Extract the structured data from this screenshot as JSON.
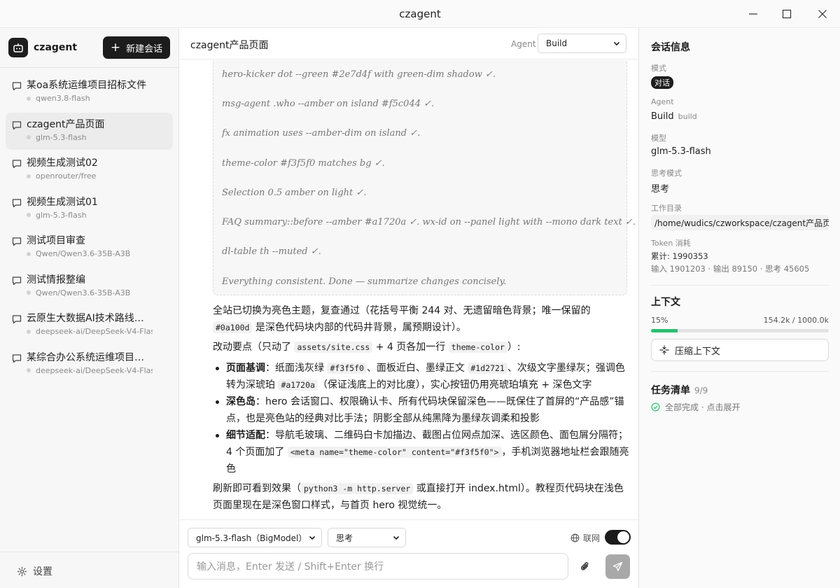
{
  "window": {
    "title": "czagent"
  },
  "sidebar": {
    "brand": "czagent",
    "new_chat_label": "新建会话",
    "conversations": [
      {
        "title": "某oa系统运维项目招标文件",
        "model": "qwen3.8-flash"
      },
      {
        "title": "czagent产品页面",
        "model": "glm-5.3-flash"
      },
      {
        "title": "视频生成测试02",
        "model": "openrouter/free"
      },
      {
        "title": "视频生成测试01",
        "model": "glm-5.3-flash"
      },
      {
        "title": "测试项目审查",
        "model": "Qwen/Qwen3.6-35B-A3B"
      },
      {
        "title": "测试情报整编",
        "model": "Qwen/Qwen3.6-35B-A3B"
      },
      {
        "title": "云原生大数据AI技术路线研究",
        "model": "deepseek-ai/DeepSeek-V4-Flash"
      },
      {
        "title": "某综合办公系统运维项目方案",
        "model": "deepseek-ai/DeepSeek-V4-Flash"
      }
    ],
    "active_index": 1,
    "settings_label": "设置"
  },
  "main": {
    "page_title": "czagent产品页面",
    "agent_label": "Agent",
    "agent_value": "Build",
    "thinking_lines": [
      "hero-kicker dot --green #2e7d4f with green-dim shadow ✓.",
      "msg-agent .who --amber on island #f5c044 ✓.",
      "fx animation uses --amber-dim on island ✓.",
      "theme-color #f3f5f0 matches bg ✓.",
      "Selection 0.5 amber on light ✓.",
      "FAQ summary::before --amber #a1720a ✓. wx-id on --panel light with --mono dark text ✓.",
      "dl-table th --muted ✓.",
      "Everything consistent. Done — summarize changes concisely."
    ],
    "answer": {
      "p1_a": "全站已切换为亮色主题，复查通过（花括号平衡 244 对、无遗留暗色背景；唯一保留的",
      "p1_code": "#0a100d",
      "p1_b": " 是深色代码块内部的代码井背景，属预期设计）。",
      "p2_a": "改动要点（只动了 ",
      "p2_code1": "assets/site.css",
      "p2_b": " + 4 页各加一行 ",
      "p2_code2": "theme-color",
      "p2_c": "）:",
      "b1_title": "页面基调",
      "b1_a": "：纸面浅灰绿 ",
      "b1_code1": "#f3f5f0",
      "b1_b": "、面板近白、墨绿正文 ",
      "b1_code2": "#1d2721",
      "b1_c": "、次级文字墨绿灰；强调色转为深琥珀 ",
      "b1_code3": "#a1720a",
      "b1_d": "（保证浅底上的对比度），实心按钮仍用亮琥珀填充 + 深色文字",
      "b2_title": "深色岛",
      "b2_text": "：hero 会话窗口、权限确认卡、所有代码块保留深色——既保住了首屏的“产品感”锚点，也是亮色站的经典对比手法；阴影全部从纯黑降为墨绿灰调柔和投影",
      "b3_title": "细节适配",
      "b3_a": "：导航毛玻璃、二维码白卡加描边、截图占位网点加深、选区颜色、面包屑分隔符；4 个页面加了 ",
      "b3_code": "<meta name=\"theme-color\" content=\"#f3f5f0\">",
      "b3_b": "，手机浏览器地址栏会跟随亮色",
      "p3_a": "刷新即可看到效果（",
      "p3_code": "python3 -m http.server",
      "p3_b": " 或直接打开 index.html）。教程页代码块在浅色页面里现在是深色窗口样式，与首页 hero 视觉统一。"
    }
  },
  "composer": {
    "model_value": "glm-5.3-flash（BigModel）",
    "thinking_value": "思考",
    "web_label": "联网",
    "web_enabled": true,
    "input_placeholder": "输入消息，Enter 发送 / Shift+Enter 换行"
  },
  "right": {
    "session_title": "会话信息",
    "mode_label": "模式",
    "mode_value": "对话",
    "agent_label": "Agent",
    "agent_value": "Build",
    "agent_sub": "build",
    "model_label": "模型",
    "model_value": "glm-5.3-flash",
    "thinking_label": "思考模式",
    "thinking_value": "思考",
    "workdir_label": "工作目录",
    "workdir_value": "/home/wudics/czworkspace/czagent产品页面",
    "token_label": "Token 消耗",
    "token_total": "累计: 1990353",
    "token_detail": "输入 1901203 · 输出 89150 · 思考 45605",
    "context_title": "上下文",
    "context_percent_label": "15%",
    "context_usage_fraction": 0.15,
    "context_amount": "154.2k / 1000.0k",
    "compress_label": "压缩上下文",
    "tasks_title": "任务清单",
    "tasks_count": "9/9",
    "tasks_status": "全部完成 · 点击展开"
  },
  "colors": {
    "accent_dark": "#1c1c1c",
    "progress_green": "#2fbf71",
    "done_green": "#2fbf71"
  }
}
